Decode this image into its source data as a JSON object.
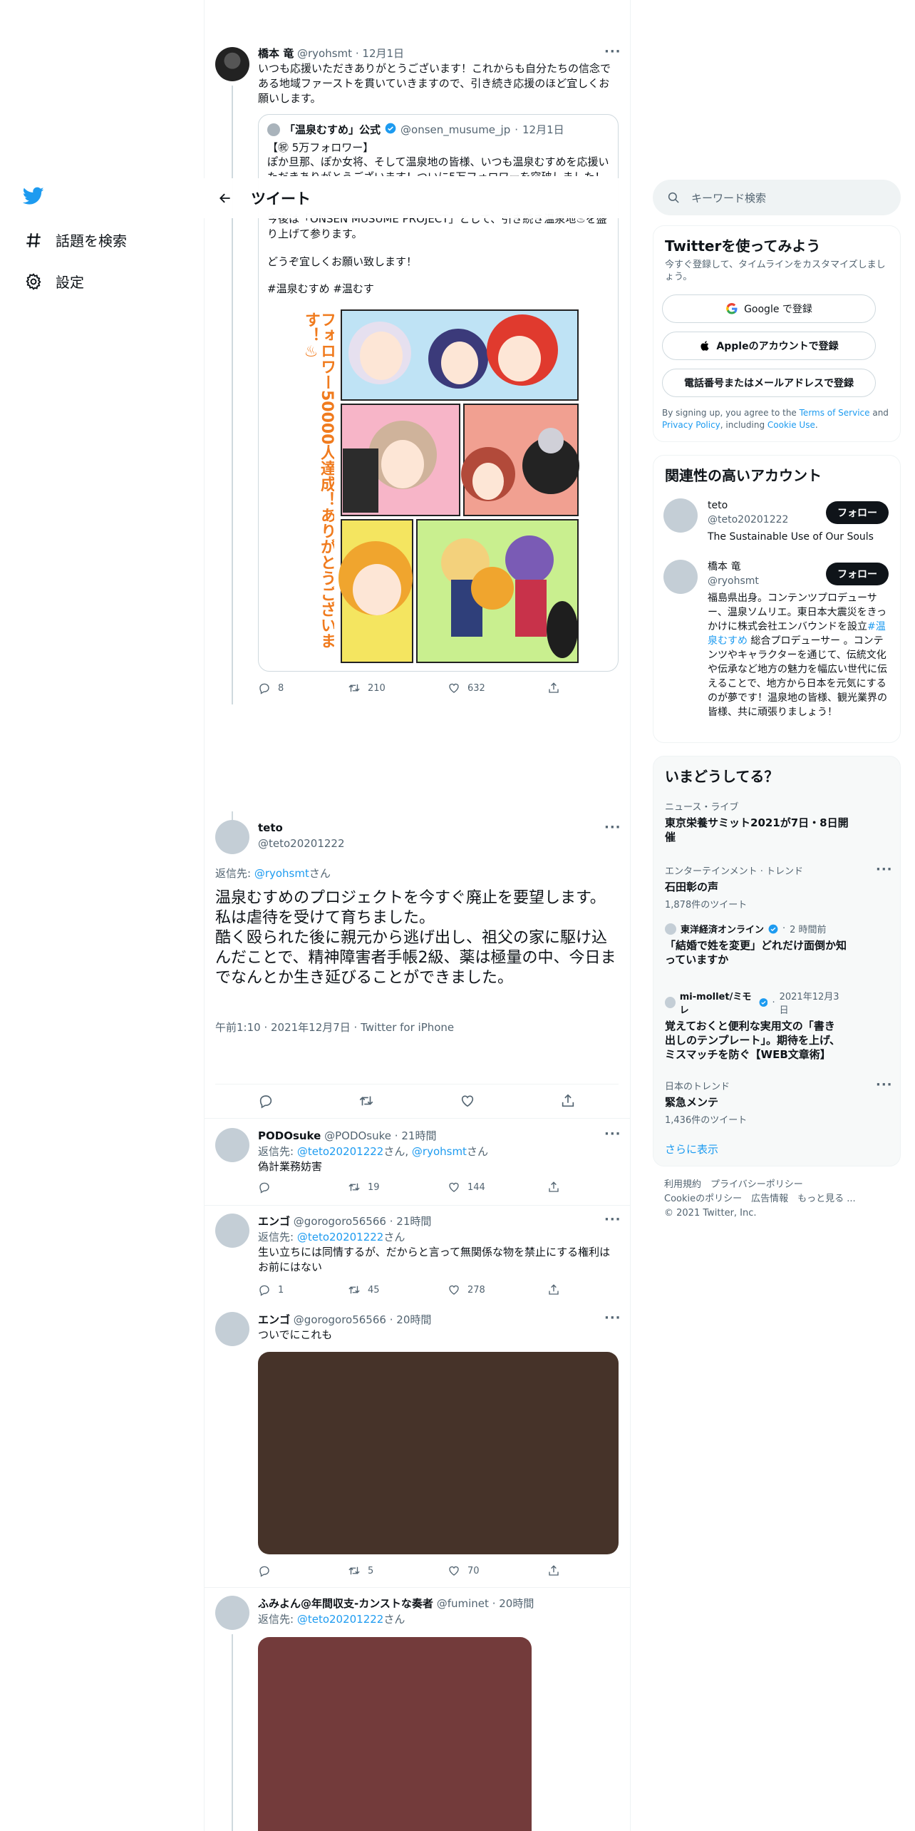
{
  "nav": {
    "explore": "話題を検索",
    "settings": "設定"
  },
  "header": {
    "title": "ツイート"
  },
  "prev_tweet": {
    "name": "橋本 竜",
    "handle": "@ryohsmt",
    "time": "12月1日",
    "text": "いつも応援いただきありがとうございます！これからも自分たちの信念である地域ファーストを貫いていきますので、引き続き応援のほど宜しくお願いします。",
    "quote": {
      "name": "「温泉むすめ」公式",
      "handle": "@onsen_musume_jp",
      "time": "12月1日",
      "line1": "【㊗ 5万フォロワー】",
      "line2": "ぽか旦那、ぽか女将、そして温泉地の皆様、いつも温泉むすめを応援いただきありがとうございます！ついに5万フォロワーを突破しました！",
      "line3": "今後は「ONSEN MUSUME PROJECT」として、引き続き温泉地♨を盛り上げて参ります。",
      "line4": "どうぞ宜しくお願い致します！",
      "tags": "#温泉むすめ #温むす",
      "banner": "フォロワー50000人達成！ありがとうございます！♨"
    },
    "replies": "8",
    "retweets": "210",
    "likes": "632"
  },
  "main_tweet": {
    "name": "teto",
    "handle": "@teto20201222",
    "reply_prefix": "返信先: ",
    "reply_to": "@ryohsmt",
    "reply_suffix": "さん",
    "line1": "温泉むすめのプロジェクトを今すぐ廃止を要望します。",
    "line2": "私は虐待を受けて育ちました。",
    "line3": "酷く殴られた後に親元から逃げ出し、祖父の家に駆け込んだことで、精神障害者手帳2級、薬は極量の中、今日までなんとか生き延びることができました。",
    "meta": "午前1:10 · 2021年12月7日 · Twitter for iPhone"
  },
  "replies": [
    {
      "name": "PODOsuke",
      "handle": "@PODOsuke",
      "time": "21時間",
      "reply_prefix": "返信先: ",
      "reply_to": "@teto20201222",
      "reply_mid": "さん, ",
      "reply_to2": "@ryohsmt",
      "reply_suffix": "さん",
      "text": "偽計業務妨害",
      "replies": "",
      "retweets": "19",
      "likes": "144"
    },
    {
      "name": "エンゴ",
      "handle": "@gorogoro56566",
      "time": "21時間",
      "reply_prefix": "返信先: ",
      "reply_to": "@teto20201222",
      "reply_suffix": "さん",
      "text": "生い立ちには同情するが、だからと言って無関係な物を禁止にする権利はお前にはない",
      "replies": "1",
      "retweets": "45",
      "likes": "278"
    },
    {
      "name": "エンゴ",
      "handle": "@gorogoro56566",
      "time": "20時間",
      "text": "ついでにこれも",
      "replies": "",
      "retweets": "5",
      "likes": "70"
    },
    {
      "name": "ふみよん@年間収支-カンストな奏者",
      "handle": "@fuminet",
      "time": "20時間",
      "reply_prefix": "返信先: ",
      "reply_to": "@teto20201222",
      "reply_suffix": "さん"
    }
  ],
  "sidebar": {
    "search_placeholder": "キーワード検索",
    "signup": {
      "title": "Twitterを使ってみよう",
      "subtitle": "今すぐ登録して、タイムラインをカスタマイズしましょう。",
      "google": "Google で登録",
      "apple": "Appleのアカウントで登録",
      "phone": "電話番号またはメールアドレスで登録",
      "terms_a": "By signing up, you agree to the ",
      "terms_link": "Terms of Service",
      "terms_b": " and ",
      "privacy_link": "Privacy Policy",
      "terms_c": ", including ",
      "cookie_link": "Cookie Use",
      "terms_d": "."
    },
    "related": {
      "title": "関連性の高いアカウント",
      "accounts": [
        {
          "name": "teto",
          "handle": "@teto20201222",
          "bio": "The Sustainable Use of Our Souls",
          "follow": "フォロー"
        },
        {
          "name": "橋本 竜",
          "handle": "@ryohsmt",
          "bio_a": "福島県出身。コンテンツプロデューサー、温泉ソムリエ。東日本大震災をきっかけに株式会社エンバウンドを設立",
          "bio_link": "#温泉むすめ",
          "bio_b": " 総合プロデューサー 。コンテンツやキャラクターを通じて、伝統文化や伝承など地方の魅力を幅広い世代に伝えることで、地方から日本を元気にするのが夢です！温泉地の皆様、観光業界の皆様、共に頑張りましょう！",
          "follow": "フォロー"
        }
      ]
    },
    "trends": {
      "title": "いまどうしてる？",
      "items": [
        {
          "category": "ニュース・ライブ",
          "title": "東京栄養サミット2021が7日・8日開催"
        },
        {
          "category": "エンターテインメント · トレンド",
          "title": "石田彰の声",
          "count": "1,878件のツイート"
        },
        {
          "source": "東洋経済オンライン",
          "time": "2 時間前",
          "title": "「結婚で姓を変更」どれだけ面倒か知っていますか"
        },
        {
          "source": "mi-mollet/ミモレ",
          "time": "2021年12月3日",
          "title": "覚えておくと便利な実用文の「書き出しのテンプレート」。期待を上げ、ミスマッチを防ぐ【WEB文章術】"
        },
        {
          "category": "日本のトレンド",
          "title": "緊急メンテ",
          "count": "1,436件のツイート"
        }
      ],
      "show_more": "さらに表示"
    },
    "footer": {
      "line1": "利用規約　プライバシーポリシー",
      "line2": "Cookieのポリシー　広告情報　もっと見る ...",
      "line3": "© 2021 Twitter, Inc."
    }
  },
  "colors": {
    "accent": "#1d9bf0",
    "image1": "#463329",
    "image2": "#733b3b"
  }
}
